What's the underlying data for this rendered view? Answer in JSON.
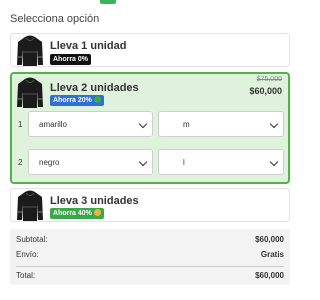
{
  "header": {
    "section_title": "Selecciona opción"
  },
  "options": [
    {
      "name": "Lleva 1 unidad",
      "badge": "Ahorra 0%",
      "badge_color": "#111111"
    },
    {
      "name": "Lleva 2 unidades",
      "badge": "Ahorra 20%",
      "badge_color": "#2f6fd6",
      "old_price": "$75,000",
      "price": "$60,000",
      "selected": true,
      "rows": [
        {
          "number": "1",
          "color": "amarillo",
          "size": "m"
        },
        {
          "number": "2",
          "color": "negro",
          "size": "l"
        }
      ]
    },
    {
      "name": "Lleva 3 unidades",
      "badge": "Ahorra 40%",
      "badge_color": "#3ba84a"
    }
  ],
  "summary": {
    "subtotal_label": "Subtotal:",
    "subtotal_value": "$60,000",
    "shipping_label": "Envío:",
    "shipping_value": "Gratis",
    "total_label": "Total:",
    "total_value": "$60,000"
  },
  "colors": {
    "accent_green": "#55b14b",
    "selected_bg": "#dff3dc"
  }
}
